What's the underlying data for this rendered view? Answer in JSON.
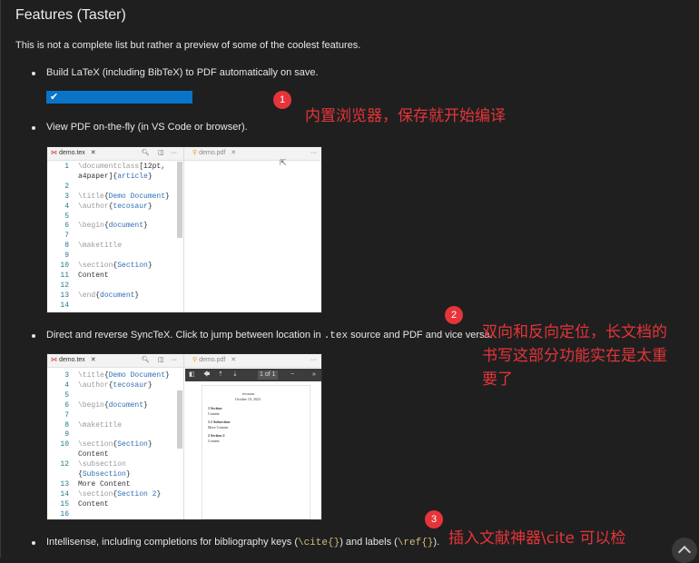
{
  "title": "Features (Taster)",
  "intro": "This is not a complete list but rather a preview of some of the coolest features.",
  "bullets": {
    "b1": "Build LaTeX (including BibTeX) to PDF automatically on save.",
    "b2": "View PDF on-the-fly (in VS Code or browser).",
    "b3_pre": "Direct and reverse SyncTeX. Click to jump between location in ",
    "b3_code": ".tex",
    "b3_post": " source and PDF and vice versa.",
    "b4_pre": "Intellisense, including completions for bibliography keys (",
    "b4_code1": "\\cite{}",
    "b4_mid": ") and labels (",
    "b4_code2": "\\ref{}",
    "b4_post": ")."
  },
  "annotations": {
    "n1": "1",
    "t1": "内置浏览器，保存就开始编译",
    "n2": "2",
    "t2a": "双向和反向定位，长文档的",
    "t2b": "书写这部分功能实在是太重",
    "t2c": "要了",
    "n3": "3",
    "t3": "插入文献神器\\cite 可以检"
  },
  "shot1": {
    "tab_tex": "demo.tex",
    "tab_pdf": "demo.pdf",
    "lines": [
      {
        "n": "1",
        "t": "\\documentclass[12pt,"
      },
      {
        "n": "",
        "t": "a4paper]{article}"
      },
      {
        "n": "2",
        "t": ""
      },
      {
        "n": "3",
        "t": "\\title{Demo Document}"
      },
      {
        "n": "4",
        "t": "\\author{tecosaur}"
      },
      {
        "n": "5",
        "t": ""
      },
      {
        "n": "6",
        "t": "\\begin{document}"
      },
      {
        "n": "7",
        "t": ""
      },
      {
        "n": "8",
        "t": "\\maketitle"
      },
      {
        "n": "9",
        "t": ""
      },
      {
        "n": "10",
        "t": "\\section{Section}"
      },
      {
        "n": "11",
        "t": "Content"
      },
      {
        "n": "12",
        "t": ""
      },
      {
        "n": "13",
        "t": "\\end{document}"
      },
      {
        "n": "14",
        "t": ""
      }
    ]
  },
  "shot2": {
    "tab_tex": "demo.tex",
    "tab_pdf": "demo.pdf",
    "page_counter": "1 of 1",
    "lines": [
      {
        "n": "3",
        "t": "\\title{Demo Document}"
      },
      {
        "n": "4",
        "t": "\\author{tecosaur}"
      },
      {
        "n": "5",
        "t": ""
      },
      {
        "n": "6",
        "t": "\\begin{document}"
      },
      {
        "n": "7",
        "t": ""
      },
      {
        "n": "8",
        "t": "\\maketitle"
      },
      {
        "n": "9",
        "t": ""
      },
      {
        "n": "10",
        "t": "\\section{Section}"
      },
      {
        "n": "",
        "t": "Content"
      },
      {
        "n": "12",
        "t": "\\subsection"
      },
      {
        "n": "",
        "t": "{Subsection}"
      },
      {
        "n": "13",
        "t": "More Content"
      },
      {
        "n": "14",
        "t": "\\section{Section 2}"
      },
      {
        "n": "15",
        "t": "Content"
      },
      {
        "n": "16",
        "t": ""
      }
    ],
    "pdf": {
      "t1": "tecosaur",
      "t2": "October 10, 2023",
      "s1": "1   Section",
      "c1": "Content",
      "s2": "1.1   Subsection",
      "c2": "More Content",
      "s3": "2   Section 2",
      "c3": "Content"
    }
  }
}
